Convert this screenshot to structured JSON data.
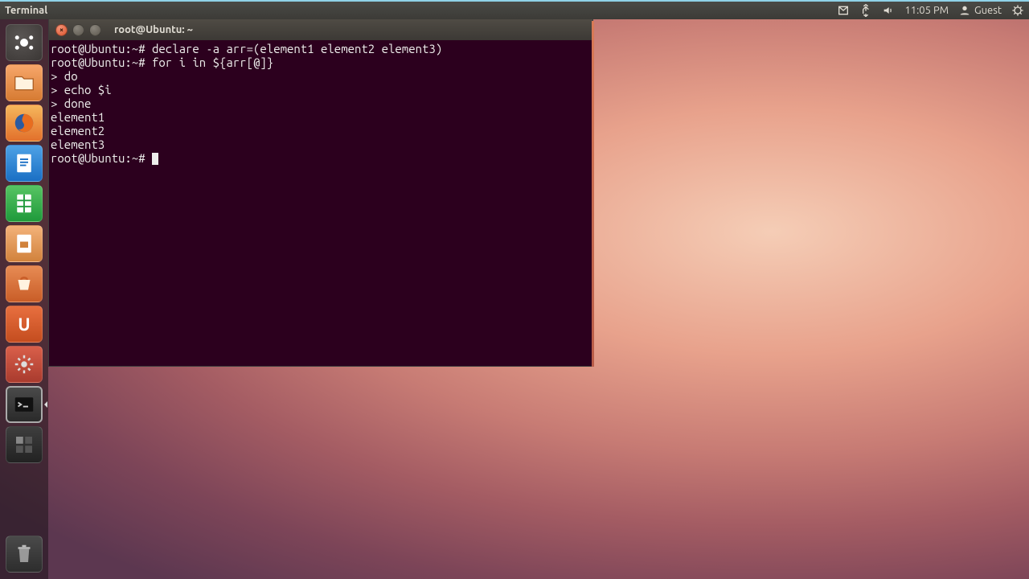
{
  "panel": {
    "app_title": "Terminal",
    "time": "11:05 PM",
    "user": "Guest"
  },
  "launcher": {
    "items": [
      {
        "name": "dash",
        "label": "Dash"
      },
      {
        "name": "files",
        "label": "Files"
      },
      {
        "name": "firefox",
        "label": "Firefox"
      },
      {
        "name": "writer",
        "label": "LibreOffice Writer"
      },
      {
        "name": "calc",
        "label": "LibreOffice Calc"
      },
      {
        "name": "impress",
        "label": "LibreOffice Impress"
      },
      {
        "name": "software",
        "label": "Ubuntu Software Center"
      },
      {
        "name": "uone",
        "label": "Ubuntu One"
      },
      {
        "name": "settings",
        "label": "System Settings"
      },
      {
        "name": "terminal",
        "label": "Terminal"
      },
      {
        "name": "workspace",
        "label": "Workspace Switcher"
      },
      {
        "name": "trash",
        "label": "Trash"
      }
    ],
    "uone_letter": "U"
  },
  "terminal": {
    "title": "root@Ubuntu: ~",
    "lines": [
      "root@Ubuntu:~# declare -a arr=(element1 element2 element3)",
      "root@Ubuntu:~# for i in ${arr[@]}",
      "> do",
      "> echo $i",
      "> done",
      "element1",
      "element2",
      "element3",
      "root@Ubuntu:~# "
    ]
  }
}
